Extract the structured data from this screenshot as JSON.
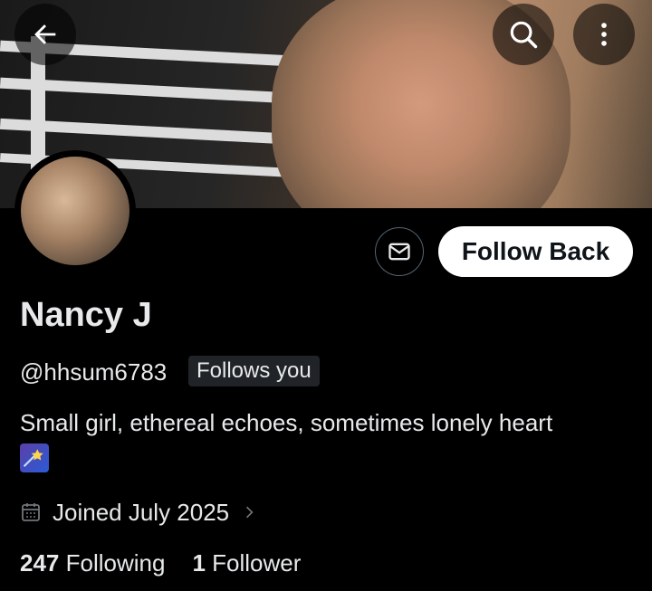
{
  "header": {
    "back_icon": "arrow-left-icon",
    "search_icon": "search-icon",
    "more_icon": "more-vertical-icon"
  },
  "profile": {
    "name": "Nancy J",
    "handle": "@hhsum6783",
    "follows_you_badge": "Follows you",
    "bio": "Small girl, ethereal echoes, sometimes lonely heart",
    "bio_emoji": "🌠",
    "joined": "Joined July 2025",
    "following_count": "247",
    "following_label": "Following",
    "followers_count": "1",
    "followers_label": "Follower"
  },
  "actions": {
    "message_icon": "envelope-icon",
    "follow_back_label": "Follow Back"
  },
  "colors": {
    "background": "#000000",
    "text_primary": "#e7e9ea",
    "text_secondary": "#71767b",
    "button_bg": "#ffffff",
    "button_text": "#0f1419",
    "badge_bg": "#202327",
    "border": "#536471"
  }
}
